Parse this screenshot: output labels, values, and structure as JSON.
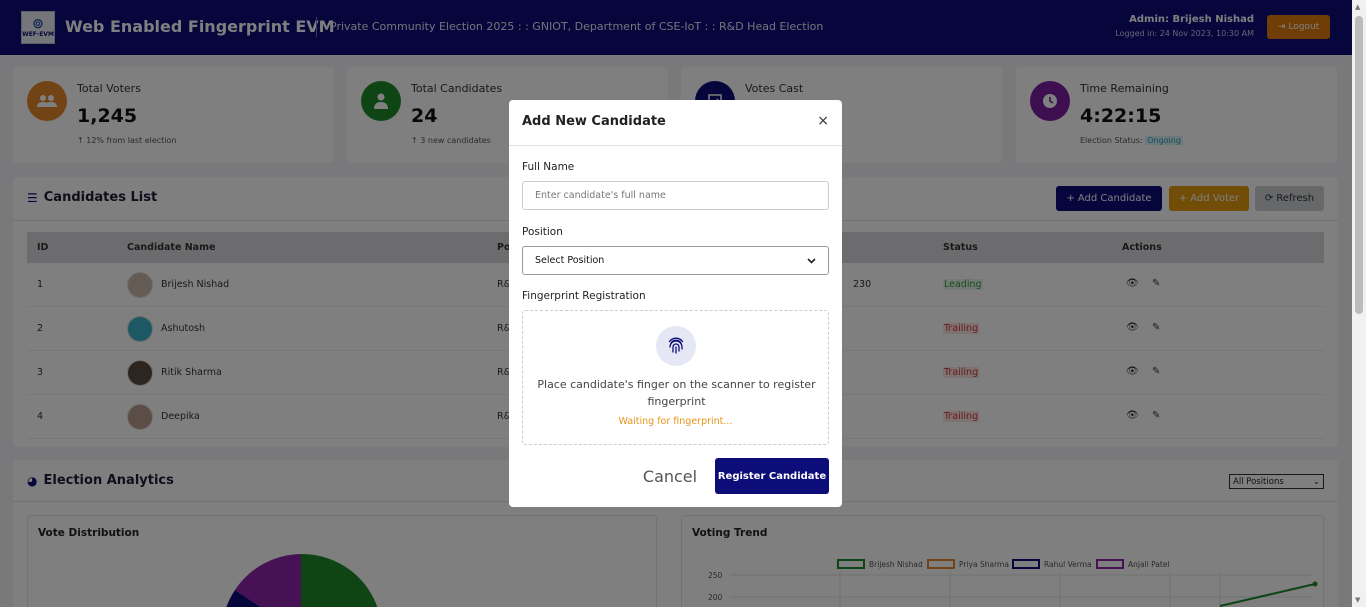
{
  "header": {
    "logo_text": "WEF-EVM",
    "app_title": "Web Enabled Fingerprint EVM",
    "election_title": "Private Community Election 2025 : : GNIOT, Department of CSE-IoT : : R&D Head Election",
    "admin_name": "Admin: Brijesh Nishad",
    "admin_login": "Logged in: 24 Nov 2023, 10:30 AM",
    "logout_label": "Logout"
  },
  "stats": [
    {
      "label": "Total Voters",
      "value": "1,245",
      "sub": "12% from last election",
      "color": "#e5892b",
      "icon": "users-icon"
    },
    {
      "label": "Total Candidates",
      "value": "24",
      "sub": "3 new candidates",
      "color": "#1f8a2a",
      "icon": "user-tie-icon"
    },
    {
      "label": "Votes Cast",
      "value": "",
      "sub": "",
      "color": "#0d0d7a",
      "icon": "vote-icon"
    },
    {
      "label": "Time Remaining",
      "value": "4:22:15",
      "sub_prefix": "Election Status:",
      "sub_status": "Ongoing",
      "color": "#7b1fa2",
      "icon": "clock-icon"
    }
  ],
  "candidates_panel": {
    "title": "Candidates List",
    "add_candidate_label": "Add Candidate",
    "add_voter_label": "Add Voter",
    "refresh_label": "Refresh",
    "columns": [
      "ID",
      "Candidate Name",
      "Po",
      "Status",
      "Actions"
    ],
    "rows": [
      {
        "id": "1",
        "name": "Brijesh Nishad",
        "pos": "R&",
        "votes": "230",
        "status": "Leading"
      },
      {
        "id": "2",
        "name": "Ashutosh",
        "pos": "R&",
        "votes": "",
        "status": "Trailing"
      },
      {
        "id": "3",
        "name": "Ritik Sharma",
        "pos": "R&",
        "votes": "",
        "status": "Trailing"
      },
      {
        "id": "4",
        "name": "Deepika",
        "pos": "R&",
        "votes": "",
        "status": "Trailing"
      }
    ]
  },
  "analytics": {
    "title": "Election Analytics",
    "filter_value": "All Positions",
    "vote_distribution_title": "Vote Distribution",
    "voting_trend_title": "Voting Trend",
    "legend": [
      "Brijesh Nishad",
      "Priya Sharma",
      "Rahul Verma",
      "Anjali Patel"
    ],
    "legend_colors": [
      "#1f8a2a",
      "#e5892b",
      "#0d0d7a",
      "#8e24aa"
    ],
    "y_ticks": [
      "250",
      "200"
    ]
  },
  "modal": {
    "title": "Add New Candidate",
    "close_symbol": "×",
    "full_name_label": "Full Name",
    "full_name_placeholder": "Enter candidate's full name",
    "position_label": "Position",
    "position_selected": "Select Position",
    "fingerprint_label": "Fingerprint Registration",
    "fingerprint_message": "Place candidate's finger on the scanner to register fingerprint",
    "fingerprint_status": "Waiting for fingerprint...",
    "cancel_label": "Cancel",
    "register_label": "Register Candidate"
  }
}
